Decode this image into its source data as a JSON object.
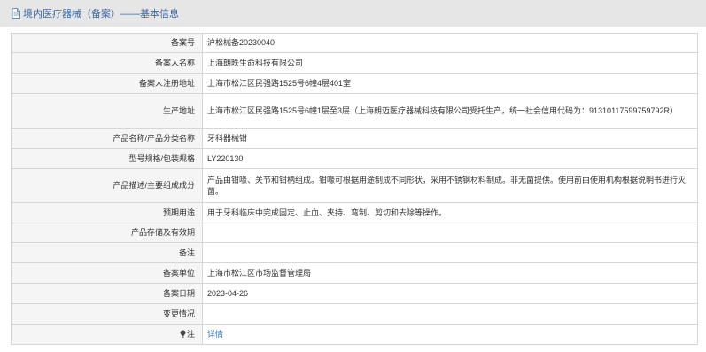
{
  "header": {
    "title": "境内医疗器械（备案）——基本信息",
    "icon": "document-icon",
    "accent_color": "#3b6aa5"
  },
  "rows": [
    {
      "label": "备案号",
      "value": "沪松械备20230040"
    },
    {
      "label": "备案人名称",
      "value": "上海朗昳生命科技有限公司"
    },
    {
      "label": "备案人注册地址",
      "value": "上海市松江区民强路1525号6幢4层401室"
    },
    {
      "label": "生产地址",
      "value": "上海市松江区民强路1525号6幢1层至3层（上海朗迈医疗器械科技有限公司受托生产，统一社会信用代码为：91310117599759792R）"
    },
    {
      "label": "产品名称/产品分类名称",
      "value": "牙科器械钳"
    },
    {
      "label": "型号规格/包装规格",
      "value": "LY220130"
    },
    {
      "label": "产品描述/主要组成成分",
      "value": "产品由钳喙、关节和钳柄组成。钳喙可根据用途制成不同形状，采用不锈钢材料制成。非无菌提供。使用前由使用机构根据说明书进行灭菌。"
    },
    {
      "label": "预期用途",
      "value": "用于牙科临床中完成固定、止血、夹持、弯制、剪切和去除等操作。"
    },
    {
      "label": "产品存储及有效期",
      "value": ""
    },
    {
      "label": "备注",
      "value": ""
    },
    {
      "label": "备案单位",
      "value": "上海市松江区市场监督管理局"
    },
    {
      "label": "备案日期",
      "value": "2023-04-26"
    },
    {
      "label": "变更情况",
      "value": ""
    }
  ],
  "footer_row": {
    "label": "注",
    "icon": "note-icon",
    "link_label": "详情",
    "link_color": "#2f6fb6"
  }
}
